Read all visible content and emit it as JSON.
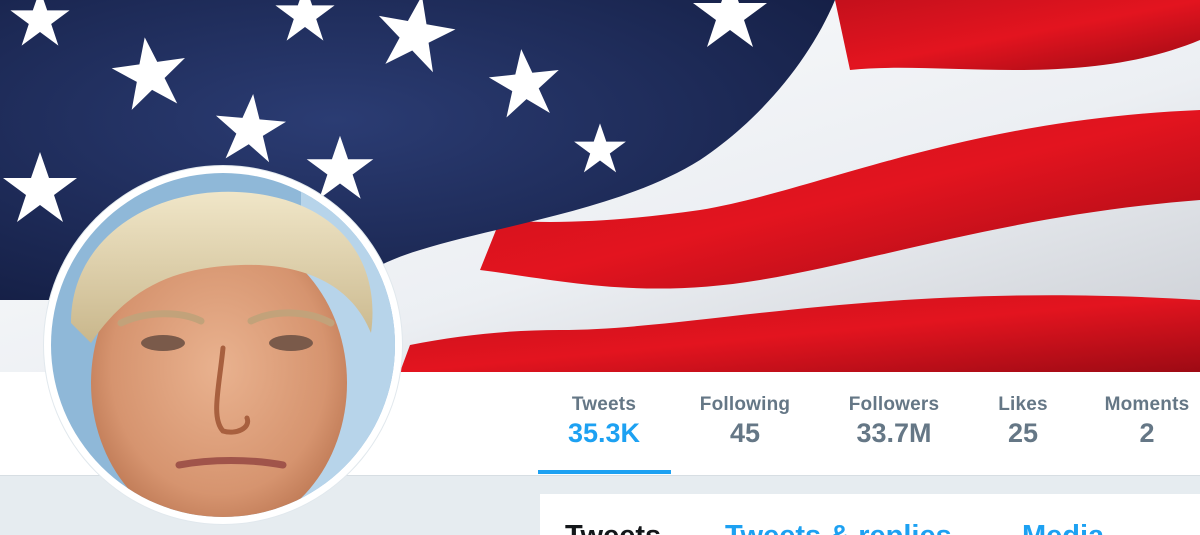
{
  "profile": {
    "banner_icon": "us-flag-image",
    "avatar_icon": "profile-photo"
  },
  "stats": [
    {
      "label": "Tweets",
      "value": "35.3K",
      "active": true
    },
    {
      "label": "Following",
      "value": "45",
      "active": false
    },
    {
      "label": "Followers",
      "value": "33.7M",
      "active": false
    },
    {
      "label": "Likes",
      "value": "25",
      "active": false
    },
    {
      "label": "Moments",
      "value": "2",
      "active": false
    }
  ],
  "tabs": [
    {
      "label": "Tweets",
      "active": true
    },
    {
      "label": "Tweets & replies",
      "active": false
    },
    {
      "label": "Media",
      "active": false
    }
  ],
  "colors": {
    "accent": "#1da1f2",
    "stat_text": "#657786",
    "background": "#e6ecf0"
  }
}
